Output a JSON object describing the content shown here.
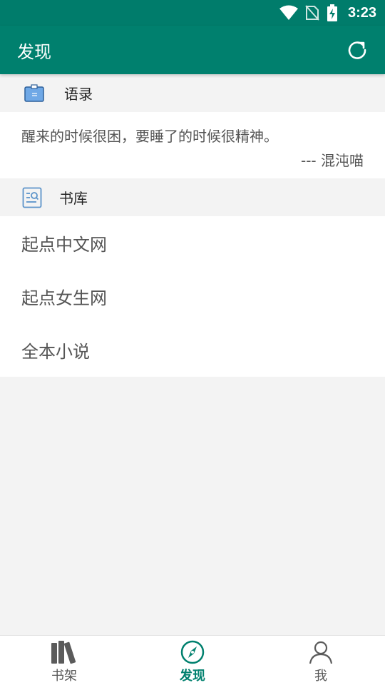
{
  "status_bar": {
    "time": "3:23"
  },
  "app_bar": {
    "title": "发现"
  },
  "quotes_section": {
    "title": "语录",
    "quote": "醒来的时候很困，要睡了的时候很精神。",
    "author": "--- 混沌喵"
  },
  "library_section": {
    "title": "书库",
    "items": [
      {
        "label": "起点中文网"
      },
      {
        "label": "起点女生网"
      },
      {
        "label": "全本小说"
      }
    ]
  },
  "bottom_nav": {
    "items": [
      {
        "label": "书架",
        "icon": "books-icon"
      },
      {
        "label": "发现",
        "icon": "compass-icon",
        "active": true
      },
      {
        "label": "我",
        "icon": "person-icon"
      }
    ]
  },
  "colors": {
    "primary": "#00806e",
    "background": "#f3f3f3"
  }
}
